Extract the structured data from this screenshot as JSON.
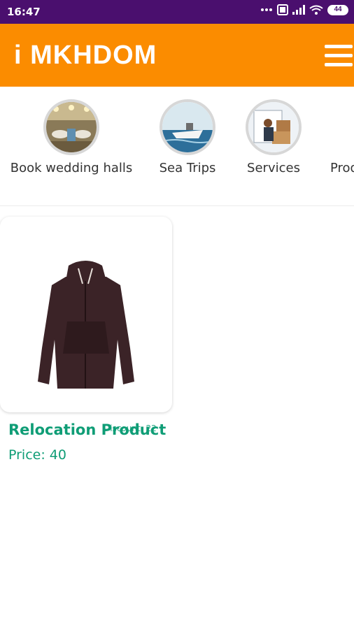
{
  "status": {
    "time": "16:47",
    "battery": "44"
  },
  "app": {
    "title": "i MKHDOM"
  },
  "categories": [
    {
      "label": "Book wedding halls",
      "icon": "wedding-hall-photo"
    },
    {
      "label": "Sea Trips",
      "icon": "boat-photo"
    },
    {
      "label": "Services",
      "icon": "movers-photo"
    },
    {
      "label": "Prod",
      "icon": "products-photo"
    }
  ],
  "product": {
    "name": "Relocation Product",
    "extra": "Discount: 22",
    "price": "Price: 40",
    "image": "hoodie-photo"
  },
  "colors": {
    "status_bar": "#4a0f6e",
    "app_bar": "#fb8c00",
    "product_text": "#0f9d76"
  }
}
